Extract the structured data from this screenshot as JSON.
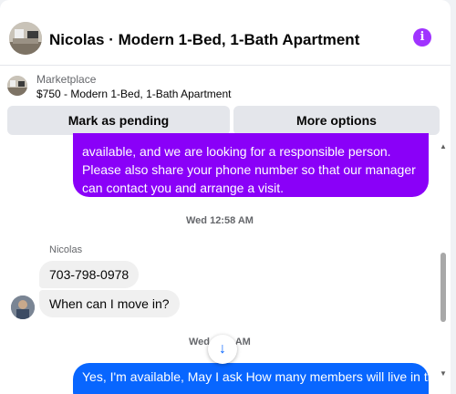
{
  "header": {
    "title": "Nicolas · Modern 1-Bed, 1-Bath Apartment",
    "info_icon": "i"
  },
  "listing": {
    "kicker": "Marketplace",
    "title": "$750 - Modern 1-Bed, 1-Bath Apartment"
  },
  "actions": {
    "pending_label": "Mark as pending",
    "more_label": "More options"
  },
  "messages": {
    "outgoing_1": "available, and we are looking for a responsible person. Please also share your phone number so that our manager can contact you and arrange a visit.",
    "timestamp_1": "Wed 12:58 AM",
    "sender": "Nicolas",
    "incoming_1": "703-798-0978",
    "incoming_2": "When can I move in?",
    "timestamp_2": "Wed 1:03 AM",
    "outgoing_2": "Yes, I'm available, May I ask How many members will live in the"
  },
  "scroll": {
    "arrow": "↓"
  },
  "colors": {
    "accent_purple": "#8a00f8",
    "accent_blue": "#0866ff",
    "incoming_bg": "#f0f0f0"
  }
}
